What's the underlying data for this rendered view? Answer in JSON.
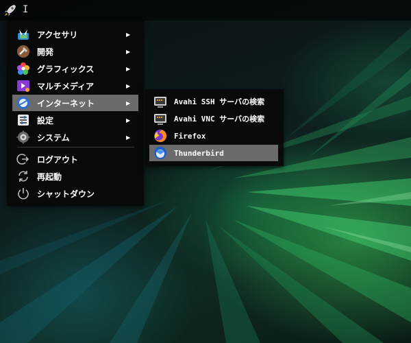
{
  "panel": {
    "cursor_text": "I"
  },
  "main_menu": {
    "items": [
      {
        "label": "アクセサリ",
        "icon": "accessories-icon",
        "has_submenu": true
      },
      {
        "label": "開発",
        "icon": "development-icon",
        "has_submenu": true
      },
      {
        "label": "グラフィックス",
        "icon": "graphics-icon",
        "has_submenu": true
      },
      {
        "label": "マルチメディア",
        "icon": "multimedia-icon",
        "has_submenu": true
      },
      {
        "label": "インターネット",
        "icon": "internet-icon",
        "has_submenu": true,
        "active": true
      },
      {
        "label": "設定",
        "icon": "settings-icon",
        "has_submenu": true
      },
      {
        "label": "システム",
        "icon": "system-icon",
        "has_submenu": true
      }
    ],
    "session_items": [
      {
        "label": "ログアウト",
        "icon": "logout-icon"
      },
      {
        "label": "再起動",
        "icon": "restart-icon"
      },
      {
        "label": "シャットダウン",
        "icon": "shutdown-icon"
      }
    ],
    "arrow_glyph": "▶"
  },
  "internet_submenu": {
    "items": [
      {
        "label": "Avahi SSH サーバの検索",
        "icon": "network-server-icon"
      },
      {
        "label": "Avahi VNC サーバの検索",
        "icon": "network-server-icon"
      },
      {
        "label": "Firefox",
        "icon": "firefox-icon"
      },
      {
        "label": "Thunderbird",
        "icon": "thunderbird-icon",
        "active": true
      }
    ]
  },
  "colors": {
    "menu_bg": "#080808",
    "highlight": "#6b6b6b",
    "text": "#ffffff",
    "accent_green": "#3cc85a"
  }
}
